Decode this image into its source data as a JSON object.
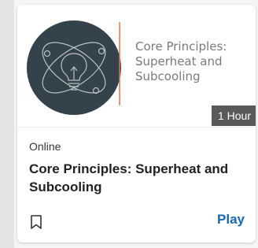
{
  "card": {
    "thumbnail_text": "Core Principles: Superheat and Subcooling",
    "duration": "1 Hour",
    "format": "Online",
    "title": "Core Principles: Superheat and Subcooling",
    "play_label": "Play",
    "bookmark_icon": "bookmark-outline-icon",
    "logo_icon": "lightbulb-atom-icon"
  },
  "colors": {
    "accent": "#1a66b5",
    "logo_circle": "#34424b",
    "divider": "#e8734a",
    "duration_bg": "#595959"
  }
}
